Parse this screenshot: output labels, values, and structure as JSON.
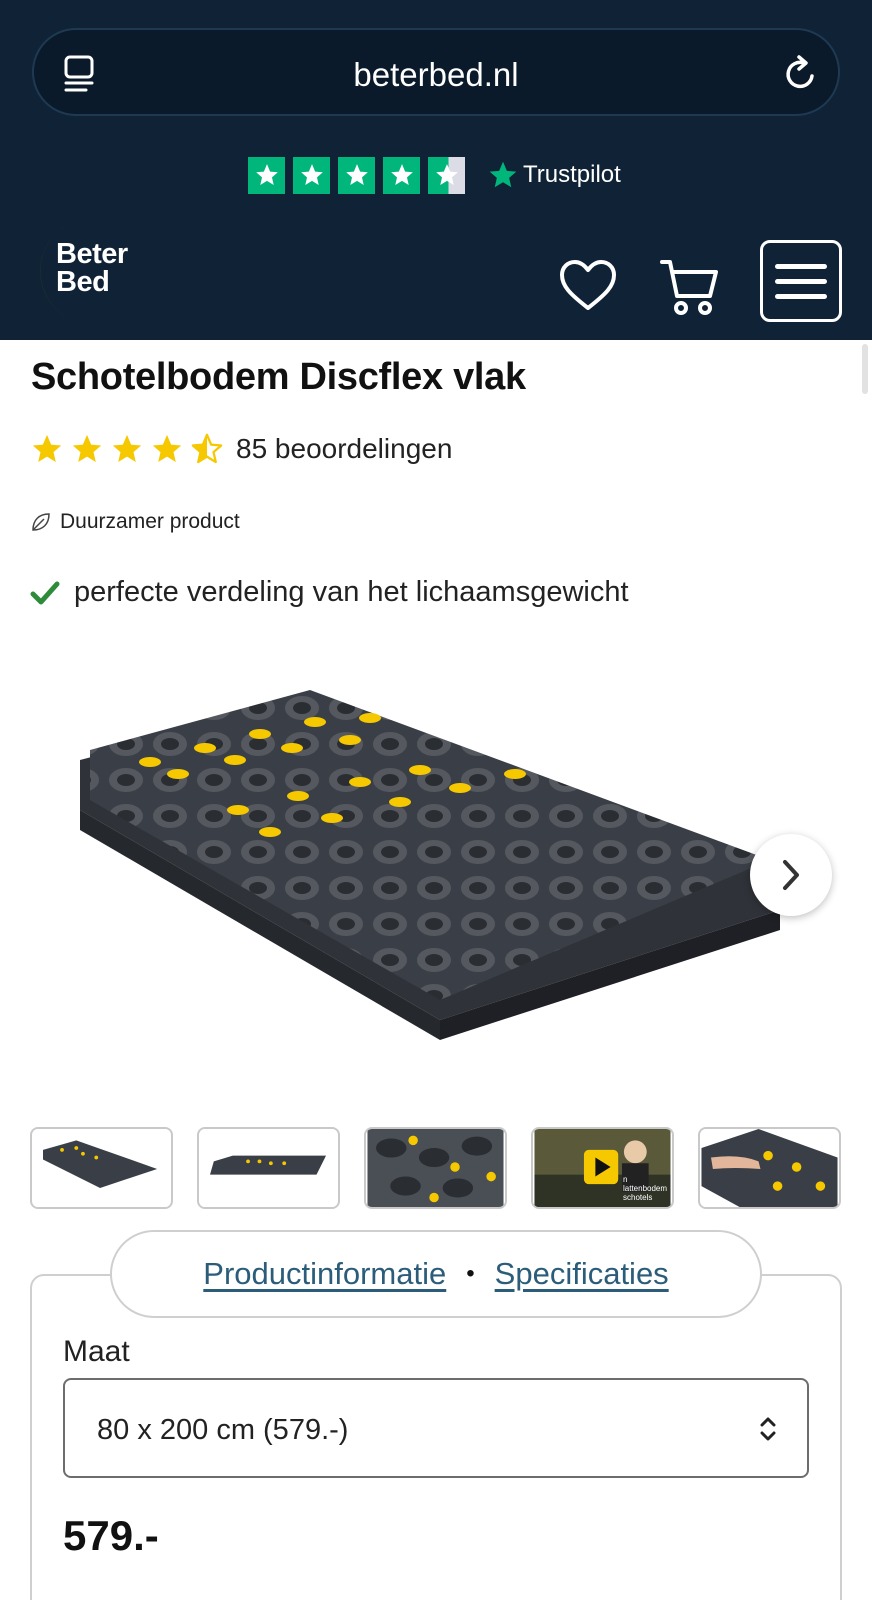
{
  "browser": {
    "url": "beterbed.nl",
    "tabs_icon": "tabs-icon",
    "reload_icon": "reload-icon"
  },
  "trustpilot": {
    "brand": "Trustpilot",
    "stars": 4.5,
    "color": "#00b67a"
  },
  "header": {
    "logo_line1": "Beter",
    "logo_line2": "Bed",
    "logo_moon_color": "#f6c800",
    "background": "#0f2236",
    "icons": [
      "heart-icon",
      "cart-icon",
      "menu-icon"
    ]
  },
  "product": {
    "title": "Schotelbodem Discflex vlak",
    "rating": 4.5,
    "rating_text": "85 beoordelingen",
    "sustainability": "Duurzamer product",
    "usp": "perfecte verdeling van het lichaamsgewicht",
    "star_color": "#f6c800",
    "check_color": "#2e8b3a"
  },
  "gallery": {
    "thumbnail_count": 5,
    "video_thumbnail_index": 3,
    "video_caption_line1": "n lattenbodem",
    "video_caption_line2": "schotels"
  },
  "info_tabs": {
    "productinfo": "Productinformatie",
    "separator": "•",
    "specs": "Specificaties",
    "link_color": "#2b5d7a"
  },
  "options": {
    "size_label": "Maat",
    "size_value": "80 x 200 cm (579.-)",
    "price": "579.-"
  }
}
